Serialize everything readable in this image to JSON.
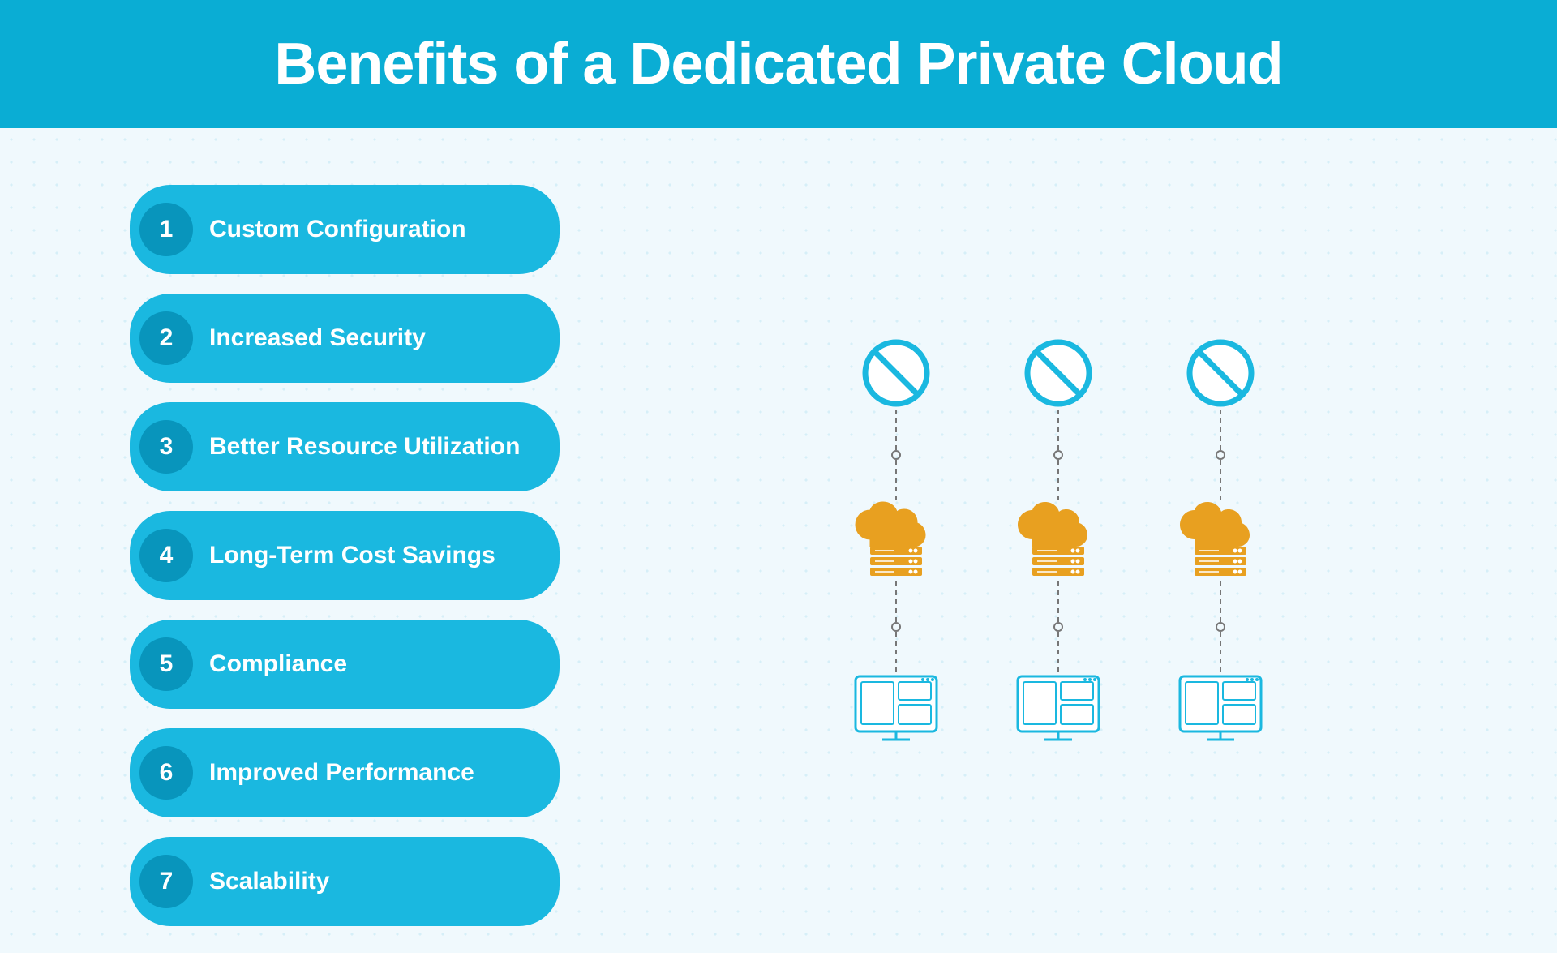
{
  "header": {
    "title": "Benefits of a Dedicated Private Cloud"
  },
  "benefits": [
    {
      "number": "1",
      "label": "Custom Configuration"
    },
    {
      "number": "2",
      "label": "Increased Security"
    },
    {
      "number": "3",
      "label": "Better Resource Utilization"
    },
    {
      "number": "4",
      "label": "Long-Term Cost Savings"
    },
    {
      "number": "5",
      "label": "Compliance"
    },
    {
      "number": "6",
      "label": "Improved Performance"
    },
    {
      "number": "7",
      "label": "Scalability"
    }
  ],
  "colors": {
    "header_bg": "#0aadd4",
    "header_text": "#ffffff",
    "benefit_bg": "#1ab8e0",
    "number_bg": "#0895bc",
    "cloud_color": "#e8a020",
    "ban_color": "#1ab8e0",
    "monitor_color": "#1ab8e0"
  }
}
